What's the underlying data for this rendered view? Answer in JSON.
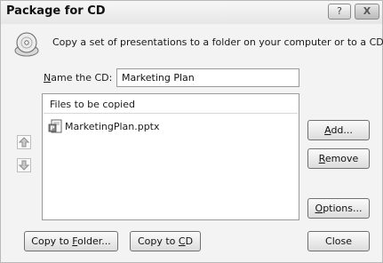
{
  "window": {
    "title": "Package for CD",
    "help_button": "?",
    "close_button": "X"
  },
  "intro": {
    "text": "Copy a set of presentations to a folder on your computer or to a CD."
  },
  "name_cd": {
    "label_first": "N",
    "label_rest": "ame the CD:",
    "value": "Marketing Plan"
  },
  "files": {
    "header": "Files to be copied",
    "items": [
      {
        "name": "MarketingPlan.pptx",
        "icon": "powerpoint-file-icon"
      }
    ]
  },
  "buttons": {
    "add": {
      "accel": "A",
      "rest": "dd..."
    },
    "remove": {
      "accel": "R",
      "rest": "emove"
    },
    "options": {
      "accel": "O",
      "rest": "ptions..."
    },
    "copy_folder": {
      "before": "Copy to ",
      "accel": "F",
      "rest": "older..."
    },
    "copy_cd": {
      "before": "Copy to ",
      "accel": "C",
      "rest": "D"
    },
    "close": {
      "label": "Close"
    }
  },
  "icons": {
    "cd": "cd-icon",
    "move_up": "move-up-arrow-icon",
    "move_down": "move-down-arrow-icon"
  }
}
